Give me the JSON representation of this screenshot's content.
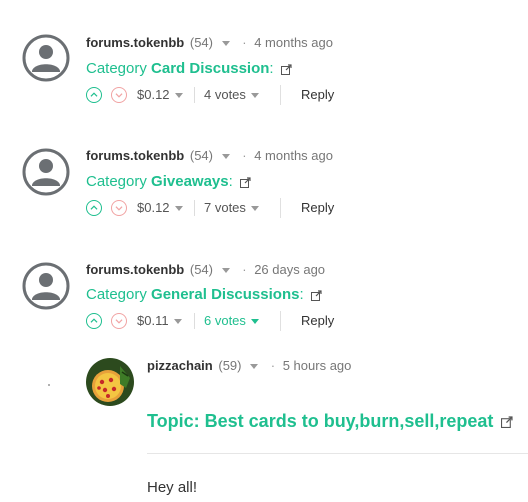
{
  "comments": [
    {
      "author": "forums.tokenbb",
      "reputation": "(54)",
      "time": "4 months ago",
      "category_prefix": "Category",
      "category_name": "Card Discussion",
      "category_suffix": ":",
      "payout": "$0.12",
      "votes": "4 votes",
      "reply_label": "Reply"
    },
    {
      "author": "forums.tokenbb",
      "reputation": "(54)",
      "time": "4 months ago",
      "category_prefix": "Category",
      "category_name": "Giveaways",
      "category_suffix": ":",
      "payout": "$0.12",
      "votes": "7 votes",
      "reply_label": "Reply"
    },
    {
      "author": "forums.tokenbb",
      "reputation": "(54)",
      "time": "26 days ago",
      "category_prefix": "Category",
      "category_name": "General Discussions",
      "category_suffix": ":",
      "payout": "$0.11",
      "votes": "6 votes",
      "reply_label": "Reply"
    }
  ],
  "reply": {
    "author": "pizzachain",
    "reputation": "(59)",
    "time": "5 hours ago",
    "topic_title": "Topic: Best cards to buy,burn,sell,repeat",
    "body": "Hey all!"
  },
  "colors": {
    "accent": "#1fbf8f",
    "downvote": "#f1a3a3",
    "text": "#333333",
    "muted": "#777777"
  },
  "icons": {
    "avatar": "default-user-avatar",
    "upvote": "chevron-up-circle-icon",
    "downvote": "chevron-down-circle-icon",
    "dropdown": "caret-down-icon",
    "external": "external-link-icon"
  }
}
